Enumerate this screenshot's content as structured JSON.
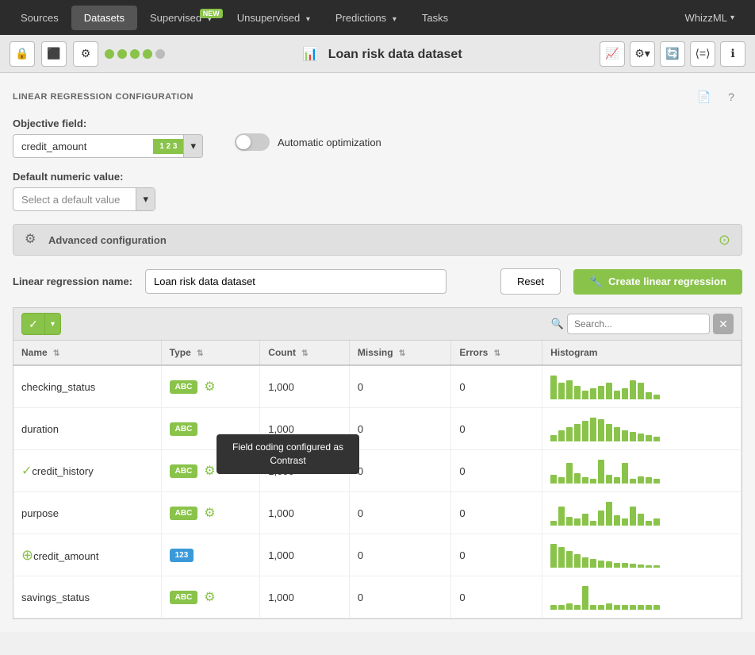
{
  "nav": {
    "items": [
      {
        "id": "sources",
        "label": "Sources",
        "active": false
      },
      {
        "id": "datasets",
        "label": "Datasets",
        "active": true
      },
      {
        "id": "supervised",
        "label": "Supervised",
        "active": false,
        "badge": "NEW"
      },
      {
        "id": "unsupervised",
        "label": "Unsupervised",
        "active": false
      },
      {
        "id": "predictions",
        "label": "Predictions",
        "active": false
      },
      {
        "id": "tasks",
        "label": "Tasks",
        "active": false
      }
    ],
    "user": "WhizzML"
  },
  "toolbar": {
    "title": "Loan risk data dataset",
    "pdf_label": "📄",
    "help_label": "?"
  },
  "config": {
    "section_title": "LINEAR REGRESSION CONFIGURATION",
    "objective_label": "Objective field:",
    "objective_value": "credit_amount",
    "objective_type": "1 2 3",
    "auto_opt_label": "Automatic optimization",
    "default_numeric_label": "Default numeric value:",
    "default_numeric_placeholder": "Select a default value",
    "advanced_label": "Advanced configuration",
    "name_label": "Linear regression name:",
    "name_value": "Loan risk data dataset",
    "reset_label": "Reset",
    "create_label": "Create linear regression"
  },
  "table": {
    "columns": [
      {
        "id": "name",
        "label": "Name"
      },
      {
        "id": "type",
        "label": "Type"
      },
      {
        "id": "count",
        "label": "Count"
      },
      {
        "id": "missing",
        "label": "Missing"
      },
      {
        "id": "errors",
        "label": "Errors"
      },
      {
        "id": "histogram",
        "label": "Histogram"
      }
    ],
    "rows": [
      {
        "name": "checking_status",
        "type": "ABC",
        "has_gear": true,
        "has_check": false,
        "is_target": false,
        "count": "1,000",
        "missing": "0",
        "errors": "0",
        "hist": [
          40,
          28,
          32,
          22,
          15,
          18,
          22,
          28,
          14,
          18,
          32,
          28,
          12,
          8
        ]
      },
      {
        "name": "duration",
        "type": "ABC",
        "has_gear": false,
        "has_check": false,
        "is_target": false,
        "count": "1,000",
        "missing": "0",
        "errors": "0",
        "hist": [
          8,
          14,
          18,
          22,
          26,
          30,
          28,
          22,
          18,
          14,
          12,
          10,
          8,
          6
        ],
        "tooltip": "Field coding configured as Contrast"
      },
      {
        "name": "credit_history",
        "type": "ABC",
        "has_gear": true,
        "has_check": true,
        "is_target": false,
        "count": "1,000",
        "missing": "0",
        "errors": "0",
        "hist": [
          12,
          8,
          28,
          14,
          8,
          6,
          32,
          12,
          8,
          28,
          6,
          10,
          8,
          6
        ]
      },
      {
        "name": "purpose",
        "type": "ABC",
        "has_gear": true,
        "has_check": false,
        "is_target": false,
        "count": "1,000",
        "missing": "0",
        "errors": "0",
        "hist": [
          6,
          22,
          10,
          8,
          14,
          6,
          18,
          28,
          12,
          8,
          22,
          14,
          6,
          8
        ]
      },
      {
        "name": "credit_amount",
        "type": "123",
        "has_gear": false,
        "has_check": false,
        "is_target": true,
        "count": "1,000",
        "missing": "0",
        "errors": "0",
        "hist": [
          32,
          28,
          22,
          18,
          14,
          12,
          10,
          8,
          6,
          6,
          5,
          4,
          3,
          3
        ]
      },
      {
        "name": "savings_status",
        "type": "ABC",
        "has_gear": true,
        "has_check": false,
        "is_target": false,
        "count": "1,000",
        "missing": "0",
        "errors": "0",
        "hist": [
          6,
          6,
          8,
          6,
          32,
          6,
          6,
          8,
          6,
          6,
          6,
          6,
          6,
          6
        ]
      }
    ]
  },
  "tooltip": {
    "text": "Field coding configured as Contrast"
  }
}
